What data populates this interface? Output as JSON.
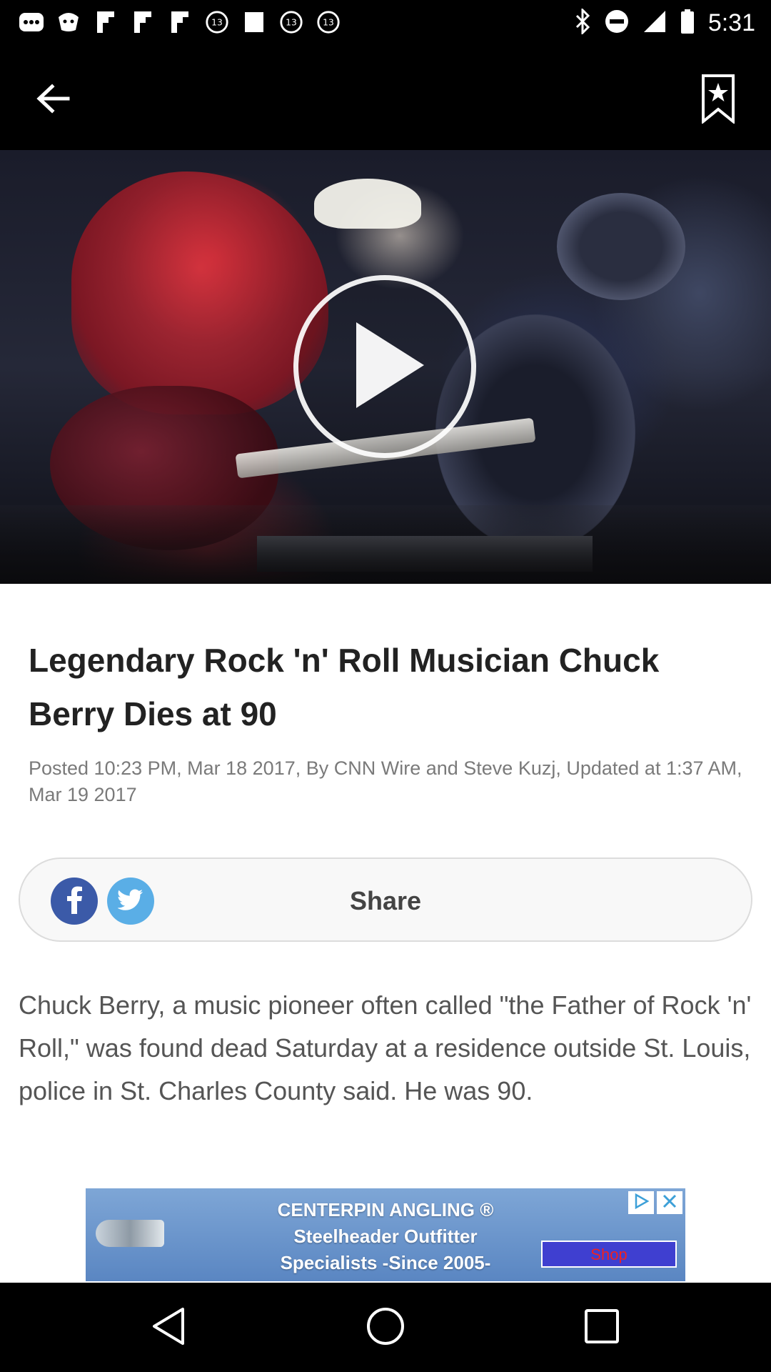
{
  "status_bar": {
    "time": "5:31",
    "left_icons": [
      "more-dots-icon",
      "app-icon",
      "flipboard-icon",
      "flipboard-icon",
      "flipboard-icon",
      "abc13-icon",
      "square-icon",
      "abc13-icon",
      "abc13-icon"
    ],
    "right_icons": [
      "bluetooth-icon",
      "do-not-disturb-icon",
      "signal-icon",
      "battery-icon"
    ]
  },
  "app_bar": {
    "back_icon": "arrow-back-icon",
    "bookmark_icon": "bookmark-star-icon"
  },
  "video": {
    "play_icon": "play-icon"
  },
  "article": {
    "headline": "Legendary Rock 'n' Roll Musician Chuck Berry Dies at 90",
    "meta": "Posted 10:23 PM, Mar 18 2017, By CNN Wire and Steve Kuzj, Updated at 1:37 AM, Mar 19 2017",
    "share_label": "Share",
    "body": "Chuck Berry, a music pioneer often called \"the Father of Rock 'n' Roll,\" was found dead Saturday at a residence outside St. Louis, police in St. Charles County said. He was 90."
  },
  "ad": {
    "line1": "CENTERPIN ANGLING ®",
    "line2": "Steelheader Outfitter",
    "line3": "Specialists -Since 2005-",
    "shop_label": "Shop"
  },
  "colors": {
    "facebook": "#3b5aa8",
    "twitter": "#5aaee6",
    "headline": "#222222",
    "meta": "#7a7a7a"
  }
}
